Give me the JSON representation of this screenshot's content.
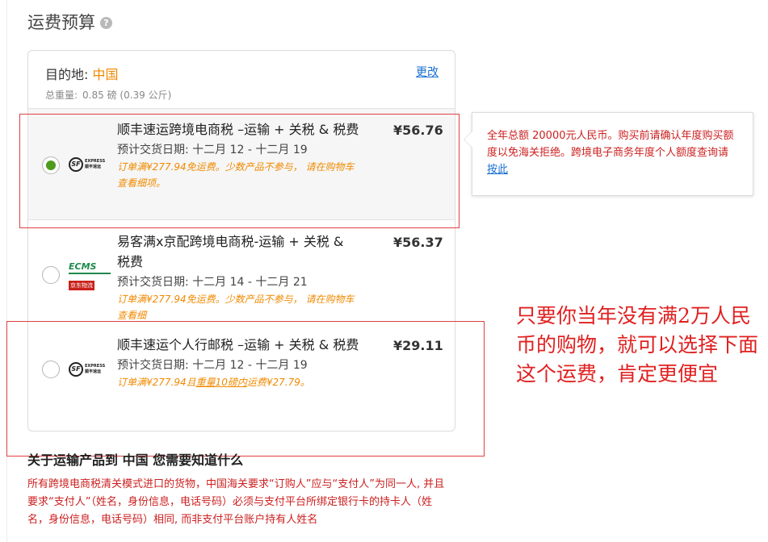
{
  "title": "运费预算",
  "help_icon": "?",
  "destination": {
    "label": "目的地:",
    "country": "中国",
    "change_link": "更改",
    "weight_label": "总重量:",
    "weight_value": "0.85 磅 (0.39 公斤)"
  },
  "options": [
    {
      "name": "顺丰速运跨境电商税 –运输 + 关税 & 税费",
      "date": "预计交货日期: 十二月 12 - 十二月 19",
      "promo": "订单满¥277.94免运费。少数产品不参与， 请在购物车查看细项。",
      "price": "¥56.76",
      "selected": true,
      "logo": "sf-express-logo"
    },
    {
      "name": "易客满x京配跨境电商税-运输 + 关税 & 税费",
      "date": "预计交货日期: 十二月 14 - 十二月 21",
      "promo": "订单满¥277.94免运费。少数产品不参与， 请在购物车查看细",
      "price": "¥56.37",
      "selected": false,
      "logo": "ecms-jd-logo"
    },
    {
      "name": "顺丰速运个人行邮税 –运输 + 关税 & 税费",
      "date": "预计交货日期: 十二月 12 - 十二月 19",
      "promo_prefix": "订单满¥277.94且",
      "promo_link": "重量10磅内",
      "promo_suffix": "运费¥27.79。",
      "price": "¥29.11",
      "selected": false,
      "logo": "sf-express-logo"
    }
  ],
  "logos": {
    "sf_mark": "SF",
    "sf_en": "EXPRESS",
    "sf_cn": "顺丰速运",
    "ecms_text": "ECMS",
    "ecms_sub": "京东物流"
  },
  "tooltip": {
    "text": "全年总额 20000元人民币。购买前请确认年度购买额度以免海关拒绝。跨境电子商务年度个人额度查询请 ",
    "link": "按此"
  },
  "annotation": "只要你当年没有满2万人民币的购物，就可以选择下面这个运费，肯定更便宜",
  "info": {
    "heading": "关于运输产品到 中国 您需要知道什么",
    "text": "所有跨境电商税清关模式进口的货物，中国海关要求“订购人”应与“支付人”为同一人, 并且要求“支付人”（姓名，身份信息，电话号码）必须与支付平台所绑定银行卡的持卡人（姓名，身份信息，电话号码）相同, 而非支付平台账户持有人姓名"
  },
  "colors": {
    "accent_orange": "#f08a00",
    "radio_green": "#4d9a1c",
    "warning_red": "#cc1f1f",
    "link_blue": "#1a6fd1"
  }
}
